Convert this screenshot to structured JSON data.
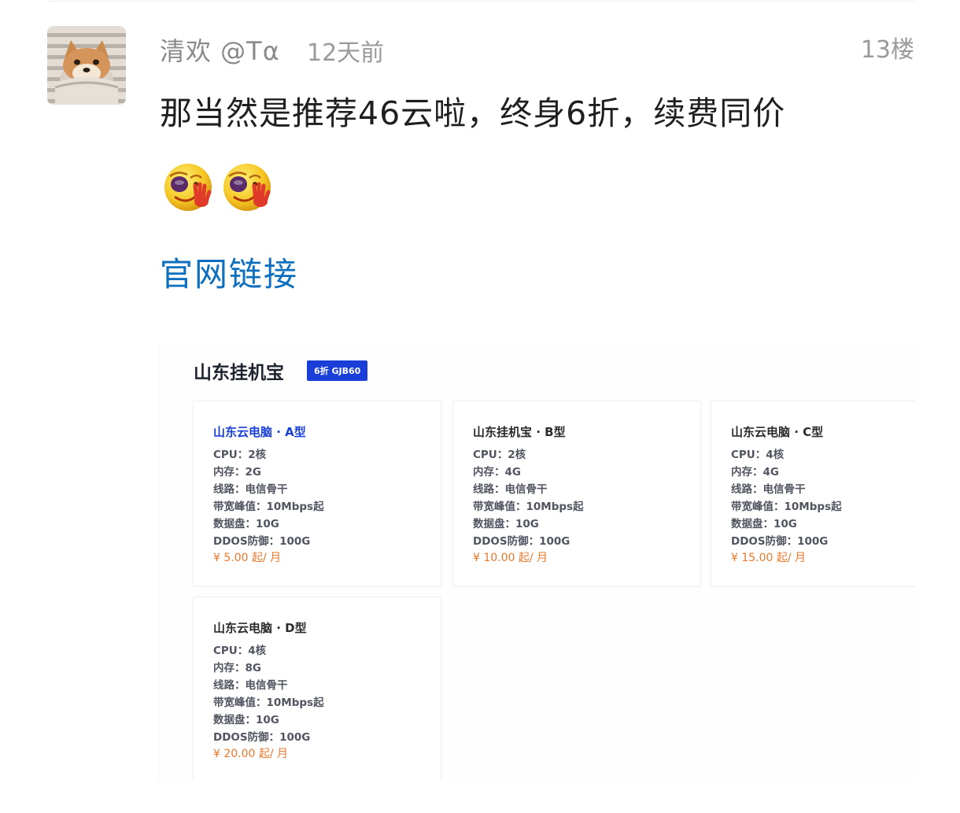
{
  "post": {
    "author": "清欢 @Tα",
    "time": "12天前",
    "floor": "13楼",
    "content": "那当然是推荐46云啦，终身6折，续费同价",
    "emojis": [
      "wave-emoji",
      "wave-emoji"
    ],
    "link_text": "官网链接"
  },
  "embed": {
    "store_title": "山东挂机宝",
    "promo_badge": "6折 GJB60",
    "accent_color": "#1a3ed8",
    "price_color": "#e8792a",
    "cards": [
      {
        "name": "山东云电脑 · A型",
        "specs": [
          "CPU：2核",
          "内存：2G",
          "线路：电信骨干",
          "带宽峰值：10Mbps起",
          "数据盘：10G",
          "DDOS防御：100G"
        ],
        "price": "¥ 5.00 起/ 月"
      },
      {
        "name": "山东挂机宝 · B型",
        "specs": [
          "CPU：2核",
          "内存：4G",
          "线路：电信骨干",
          "带宽峰值：10Mbps起",
          "数据盘：10G",
          "DDOS防御：100G"
        ],
        "price": "¥ 10.00 起/ 月"
      },
      {
        "name": "山东云电脑 · C型",
        "specs": [
          "CPU：4核",
          "内存：4G",
          "线路：电信骨干",
          "带宽峰值：10Mbps起",
          "数据盘：10G",
          "DDOS防御：100G"
        ],
        "price": "¥ 15.00 起/ 月"
      },
      {
        "name": "山东云电脑 · D型",
        "specs": [
          "CPU：4核",
          "内存：8G",
          "线路：电信骨干",
          "带宽峰值：10Mbps起",
          "数据盘：10G",
          "DDOS防御：100G"
        ],
        "price": "¥ 20.00 起/ 月"
      }
    ]
  }
}
